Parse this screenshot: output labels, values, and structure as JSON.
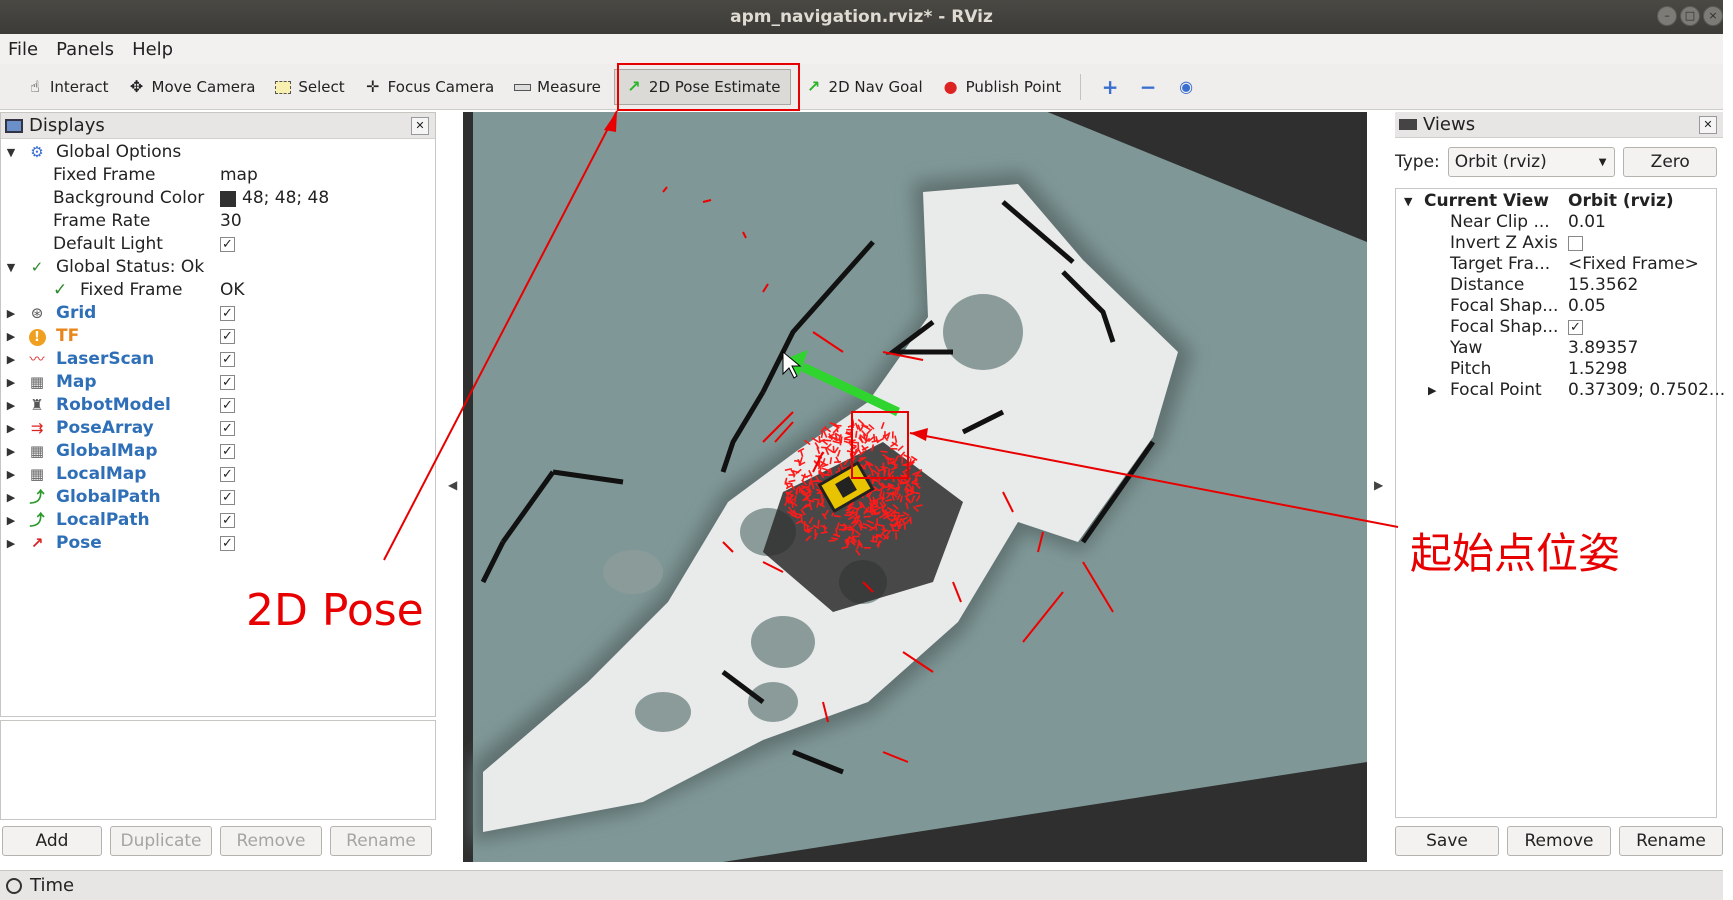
{
  "window": {
    "title": "apm_navigation.rviz* - RViz"
  },
  "menu": [
    "File",
    "Panels",
    "Help"
  ],
  "toolbar": [
    {
      "label": "Interact",
      "icon": "hand-pointer-icon"
    },
    {
      "label": "Move Camera",
      "icon": "move-camera-icon"
    },
    {
      "label": "Select",
      "icon": "select-rect-icon"
    },
    {
      "label": "Focus Camera",
      "icon": "focus-camera-icon"
    },
    {
      "label": "Measure",
      "icon": "ruler-icon"
    },
    {
      "label": "2D Pose Estimate",
      "icon": "green-arrow-icon",
      "active": true
    },
    {
      "label": "2D Nav Goal",
      "icon": "green-arrow-icon"
    },
    {
      "label": "Publish Point",
      "icon": "map-pin-icon"
    }
  ],
  "displays": {
    "title": "Displays",
    "global_options": {
      "label": "Global Options",
      "rows": [
        {
          "label": "Fixed Frame",
          "value": "map"
        },
        {
          "label": "Background Color",
          "value": "48; 48; 48",
          "swatch": "#303030"
        },
        {
          "label": "Frame Rate",
          "value": "30"
        },
        {
          "label": "Default Light",
          "checked": true
        }
      ]
    },
    "global_status": {
      "label": "Global Status: Ok",
      "child_label": "Fixed Frame",
      "child_value": "OK"
    },
    "items": [
      {
        "name": "Grid",
        "icon": "grid-icon",
        "color": "#2e6fb7",
        "checked": true
      },
      {
        "name": "TF",
        "icon": "warning-icon",
        "color": "#e8861c",
        "checked": true
      },
      {
        "name": "LaserScan",
        "icon": "laserscan-icon",
        "color": "#2e6fb7",
        "checked": true
      },
      {
        "name": "Map",
        "icon": "map-icon",
        "color": "#2e6fb7",
        "checked": true
      },
      {
        "name": "RobotModel",
        "icon": "robot-icon",
        "color": "#2e6fb7",
        "checked": true
      },
      {
        "name": "PoseArray",
        "icon": "pose-array-icon",
        "color": "#2e6fb7",
        "checked": true
      },
      {
        "name": "GlobalMap",
        "icon": "map-icon",
        "color": "#2e6fb7",
        "checked": true
      },
      {
        "name": "LocalMap",
        "icon": "map-icon",
        "color": "#2e6fb7",
        "checked": true
      },
      {
        "name": "GlobalPath",
        "icon": "path-icon",
        "color": "#2e6fb7",
        "checked": true
      },
      {
        "name": "LocalPath",
        "icon": "path-icon",
        "color": "#2e6fb7",
        "checked": true
      },
      {
        "name": "Pose",
        "icon": "pose-arrow-icon",
        "color": "#2e6fb7",
        "checked": true
      }
    ],
    "buttons": {
      "add": "Add",
      "duplicate": "Duplicate",
      "remove": "Remove",
      "rename": "Rename"
    }
  },
  "views": {
    "title": "Views",
    "type_label": "Type:",
    "type_value": "Orbit (rviz)",
    "zero": "Zero",
    "current_view": {
      "label": "Current View",
      "value": "Orbit (rviz)"
    },
    "props": [
      {
        "label": "Near Clip ...",
        "value": "0.01"
      },
      {
        "label": "Invert Z Axis",
        "checkbox": true,
        "checked": false
      },
      {
        "label": "Target Fra...",
        "value": "<Fixed Frame>"
      },
      {
        "label": "Distance",
        "value": "15.3562"
      },
      {
        "label": "Focal Shap...",
        "value": "0.05"
      },
      {
        "label": "Focal Shap...",
        "checkbox": true,
        "checked": true
      },
      {
        "label": "Yaw",
        "value": "3.89357"
      },
      {
        "label": "Pitch",
        "value": "1.5298"
      },
      {
        "label": "Focal Point",
        "value": "0.37309; 0.7502...",
        "expandable": true
      }
    ],
    "buttons": {
      "save": "Save",
      "remove": "Remove",
      "rename": "Rename"
    }
  },
  "time_panel": {
    "title": "Time"
  },
  "annotations": {
    "left": "2D Pose",
    "right": "起始点位姿",
    "color": "#e80000"
  }
}
